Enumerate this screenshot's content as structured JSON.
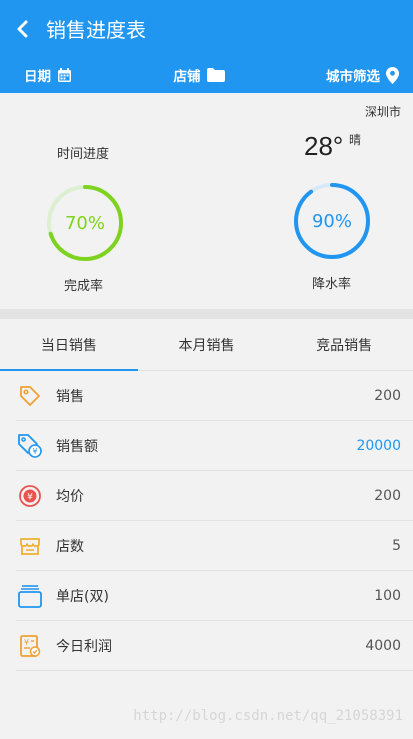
{
  "header": {
    "title": "销售进度表",
    "filters": [
      {
        "label": "日期",
        "icon": "calendar-icon"
      },
      {
        "label": "店铺",
        "icon": "folder-icon"
      },
      {
        "label": "城市筛选",
        "icon": "location-pin-icon"
      }
    ]
  },
  "summary": {
    "city": "深圳市",
    "time_progress_title": "时间进度",
    "completion": {
      "value": "70%",
      "percent": 70,
      "label": "完成率",
      "color": "#7ed321"
    },
    "temperature": "28°",
    "weather": "晴",
    "rain": {
      "value": "90%",
      "percent": 90,
      "label": "降水率",
      "color": "#2196f0"
    }
  },
  "tabs": [
    "当日销售",
    "本月销售",
    "竞品销售"
  ],
  "list": [
    {
      "label": "销售",
      "value": "200",
      "icon": "tag-icon"
    },
    {
      "label": "销售额",
      "value": "20000",
      "icon": "price-tag-icon"
    },
    {
      "label": "均价",
      "value": "200",
      "icon": "yuan-icon"
    },
    {
      "label": "店数",
      "value": "5",
      "icon": "store-icon"
    },
    {
      "label": "单店(双)",
      "value": "100",
      "icon": "box-stack-icon"
    },
    {
      "label": "今日利润",
      "value": "4000",
      "icon": "profit-receipt-icon"
    }
  ],
  "watermark": "http://blog.csdn.net/qq_21058391"
}
